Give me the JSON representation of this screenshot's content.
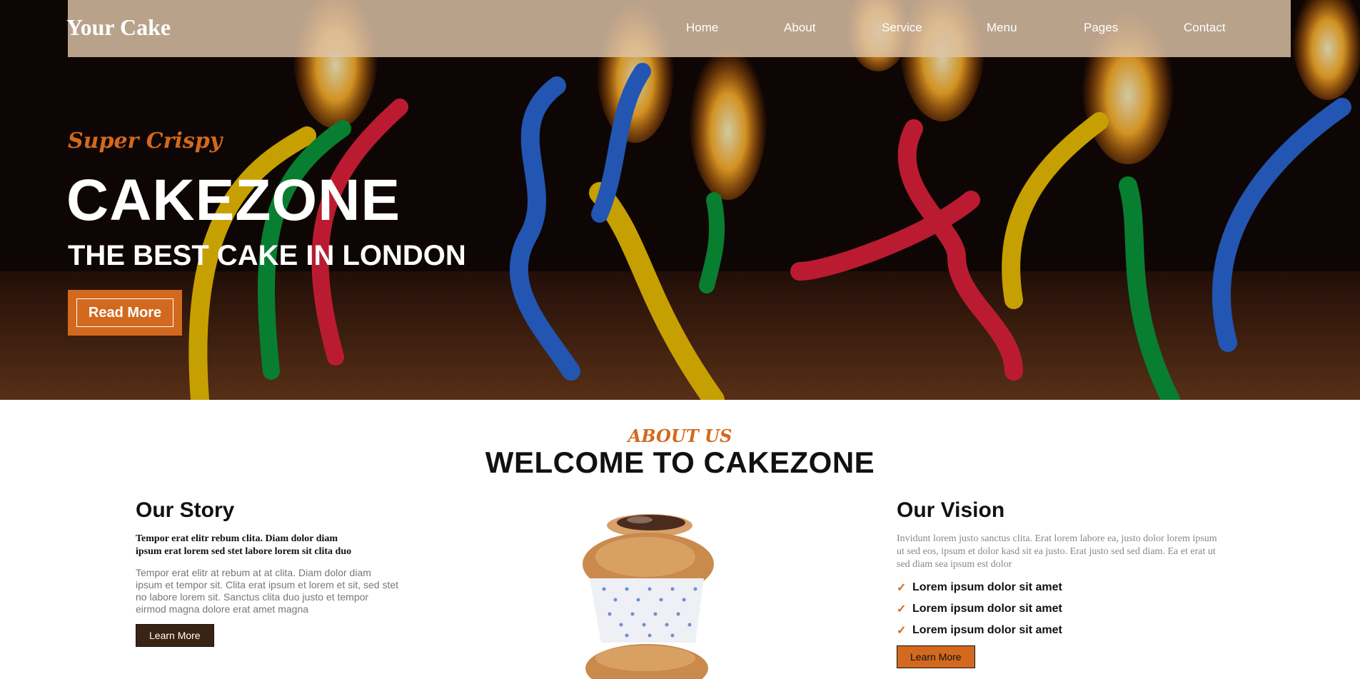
{
  "brand": "Your Cake",
  "nav": {
    "items": [
      {
        "label": "Home"
      },
      {
        "label": "About"
      },
      {
        "label": "Service"
      },
      {
        "label": "Menu"
      },
      {
        "label": "Pages"
      },
      {
        "label": "Contact"
      }
    ]
  },
  "hero": {
    "tagline": "Super Crispy",
    "title": "CAKEZONE",
    "subtitle": "THE BEST CAKE IN LONDON",
    "button_label": "Read More"
  },
  "about": {
    "eyebrow": "ABOUT US",
    "title": "WELCOME TO CAKEZONE",
    "story": {
      "heading": "Our Story",
      "lead": "Tempor erat elitr rebum clita. Diam dolor diam ipsum erat lorem sed stet labore lorem sit clita duo",
      "body": "Tempor erat elitr at rebum at at clita. Diam dolor diam ipsum et tempor sit. Clita erat ipsum et lorem et sit, sed stet no labore lorem sit. Sanctus clita duo justo et tempor eirmod magna dolore erat amet magna",
      "button_label": "Learn More"
    },
    "vision": {
      "heading": "Our Vision",
      "body": "Invidunt lorem justo sanctus clita. Erat lorem labore ea, justo dolor lorem ipsum ut sed eos, ipsum et dolor kasd sit ea justo. Erat justo sed sed diam. Ea et erat ut sed diam sea ipsum est dolor",
      "list": [
        {
          "text": "Lorem ipsum dolor sit amet",
          "icon": "check-icon"
        },
        {
          "text": "Lorem ipsum dolor sit amet",
          "icon": "check-icon"
        },
        {
          "text": "Lorem ipsum dolor sit amet",
          "icon": "check-icon"
        }
      ],
      "button_label": "Learn More"
    }
  },
  "colors": {
    "accent": "#d2691e",
    "dark_button": "#3b2314",
    "navbar": "#dec4a8"
  }
}
